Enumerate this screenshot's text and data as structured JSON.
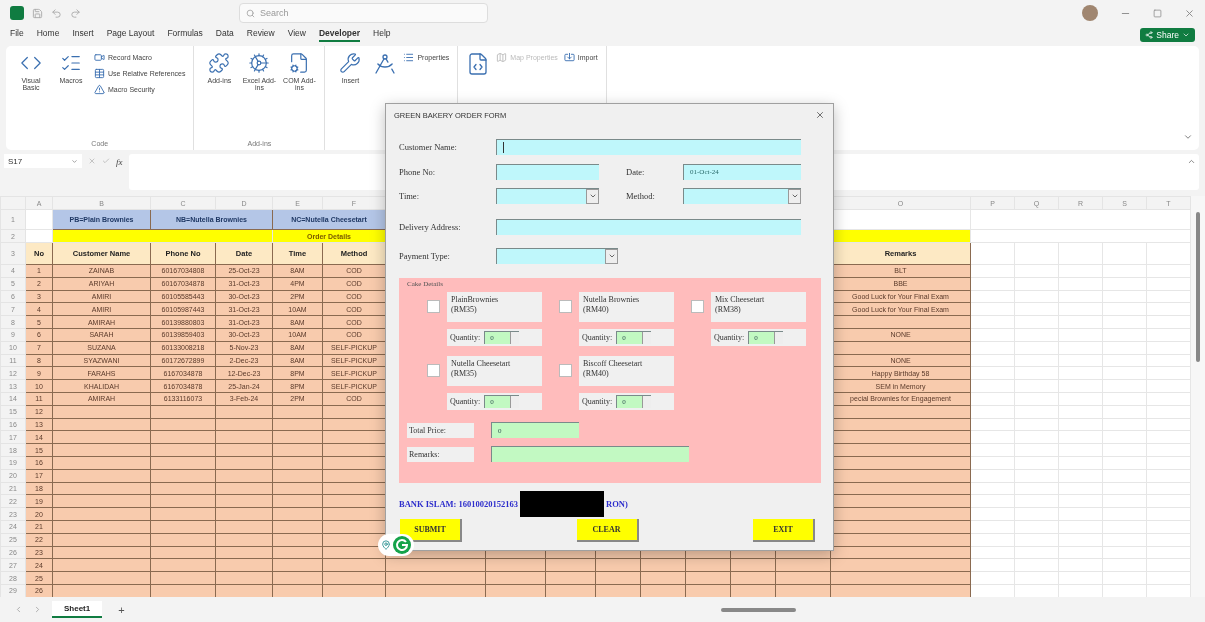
{
  "title_bar": {
    "search_placeholder": "Search"
  },
  "menu_tabs": [
    {
      "label": "File",
      "selected": false
    },
    {
      "label": "Home",
      "selected": false
    },
    {
      "label": "Insert",
      "selected": false
    },
    {
      "label": "Page Layout",
      "selected": false
    },
    {
      "label": "Formulas",
      "selected": false
    },
    {
      "label": "Data",
      "selected": false
    },
    {
      "label": "Review",
      "selected": false
    },
    {
      "label": "View",
      "selected": false
    },
    {
      "label": "Developer",
      "selected": true
    },
    {
      "label": "Help",
      "selected": false
    }
  ],
  "share_button": "Share",
  "ribbon": [
    {
      "label": "Code",
      "items": [
        {
          "kind": "large",
          "label": "Visual Basic"
        },
        {
          "kind": "large",
          "label": "Macros"
        },
        {
          "kind": "stack",
          "items": [
            {
              "label": "Record Macro",
              "disabled": false
            },
            {
              "label": "Use Relative References",
              "disabled": false
            },
            {
              "label": "Macro Security",
              "disabled": false
            }
          ]
        }
      ]
    },
    {
      "label": "Add-ins",
      "items": [
        {
          "kind": "large",
          "label": "Add-ins"
        },
        {
          "kind": "large",
          "label": "Excel Add-ins"
        },
        {
          "kind": "large",
          "label": "COM Add-ins"
        }
      ]
    },
    {
      "items": [
        {
          "kind": "large",
          "label": "Insert"
        },
        {
          "kind": "icon"
        },
        {
          "kind": "stack",
          "items": [
            {
              "label": "Properties",
              "disabled": false
            }
          ]
        }
      ]
    },
    {
      "items": [
        {
          "kind": "icon"
        },
        {
          "kind": "stack",
          "items": [
            {
              "label": "Map Properties",
              "disabled": true
            }
          ]
        },
        {
          "kind": "stack",
          "items": [
            {
              "label": "Import",
              "disabled": false
            }
          ]
        }
      ]
    }
  ],
  "formula_bar": {
    "name_box": "S17",
    "fx": "fx"
  },
  "sheet": {
    "column_letters": [
      "A",
      "B",
      "C",
      "D",
      "E",
      "F",
      "O",
      "P",
      "Q",
      "R",
      "S",
      "T"
    ],
    "banner": [
      "PB=Plain Brownies",
      "NB=Nutella Brownies",
      "NC=Nutella Cheesetart"
    ],
    "section_title": "Order Details",
    "headers": [
      "No",
      "Customer Name",
      "Phone No",
      "Date",
      "Time",
      "Method",
      "Remarks"
    ],
    "row_numbers": [
      "1",
      "2",
      "3",
      "4",
      "5",
      "6",
      "7",
      "8",
      "9",
      "10",
      "11",
      "12",
      "13",
      "14",
      "15",
      "16",
      "17",
      "18",
      "19",
      "20",
      "21",
      "22",
      "23",
      "24",
      "25",
      "26",
      "27",
      "28",
      "29"
    ],
    "rows": [
      {
        "no": "1",
        "name": "ZAINAB",
        "phone": "60167034808",
        "date": "25-Oct-23",
        "time": "8AM",
        "method": "COD",
        "remarks": "BLT"
      },
      {
        "no": "2",
        "name": "ARIYAH",
        "phone": "60167034878",
        "date": "31-Oct-23",
        "time": "4PM",
        "method": "COD",
        "remarks": "BBE"
      },
      {
        "no": "3",
        "name": "AMIRI",
        "phone": "60105585443",
        "date": "30-Oct-23",
        "time": "2PM",
        "method": "COD",
        "remarks": "Good Luck for Your Final Exam"
      },
      {
        "no": "4",
        "name": "AMIRI",
        "phone": "60105987443",
        "date": "31-Oct-23",
        "time": "10AM",
        "method": "COD",
        "remarks": "Good Luck for Your Final Exam"
      },
      {
        "no": "5",
        "name": "AMIRAH",
        "phone": "60139880803",
        "date": "31-Oct-23",
        "time": "8AM",
        "method": "COD"
      },
      {
        "no": "6",
        "name": "SARAH",
        "phone": "60139859403",
        "date": "30-Oct-23",
        "time": "10AM",
        "method": "COD",
        "remarks": "NONE"
      },
      {
        "no": "7",
        "name": "SUZANA",
        "phone": "60133008218",
        "date": "5-Nov-23",
        "time": "8AM",
        "method": "SELF-PICKUP"
      },
      {
        "no": "8",
        "name": "SYAZWANI",
        "phone": "60172672899",
        "date": "2-Dec-23",
        "time": "8AM",
        "method": "SELF-PICKUP",
        "remarks": "NONE"
      },
      {
        "no": "9",
        "name": "FARAHS",
        "phone": "6167034878",
        "date": "12-Dec-23",
        "time": "8PM",
        "method": "SELF-PICKUP",
        "remarks": "Happy Birthday 58"
      },
      {
        "no": "10",
        "name": "KHALIDAH",
        "phone": "6167034878",
        "date": "25-Jan-24",
        "time": "8PM",
        "method": "SELF-PICKUP",
        "remarks": "SEM in Memory"
      },
      {
        "no": "11",
        "name": "AMIRAH",
        "phone": "6133116073",
        "date": "3-Feb-24",
        "time": "2PM",
        "method": "COD",
        "remarks": "pecial Brownies for Engagement"
      },
      {
        "no": "12"
      },
      {
        "no": "13"
      },
      {
        "no": "14"
      },
      {
        "no": "15"
      },
      {
        "no": "16"
      },
      {
        "no": "17"
      },
      {
        "no": "18"
      },
      {
        "no": "19"
      },
      {
        "no": "20"
      },
      {
        "no": "21"
      },
      {
        "no": "22"
      },
      {
        "no": "23"
      },
      {
        "no": "24"
      },
      {
        "no": "25"
      },
      {
        "no": "26"
      }
    ]
  },
  "dialog": {
    "title": "GREEN BAKERY ORDER FORM",
    "form_rows": [
      [
        {
          "label": "Customer Name:",
          "kind": "text",
          "focused": true
        }
      ],
      [
        {
          "label": "Phone No:",
          "kind": "text",
          "focused": false
        },
        {
          "label": "Date:",
          "kind": "text",
          "focused": false,
          "value": "01-Oct-24"
        }
      ],
      [
        {
          "label": "Time:",
          "kind": "combo",
          "focused": false
        },
        {
          "label": "Method:",
          "kind": "combo",
          "focused": false
        }
      ],
      [
        {
          "label": "Delivery Address:",
          "kind": "text",
          "focused": false
        }
      ],
      [
        {
          "label": "Payment Type:",
          "kind": "combo",
          "focused": false
        }
      ]
    ],
    "cake_details": {
      "title": "Cake Details",
      "items": [
        {
          "label": "PlainBrownies (RM35)",
          "checked": false,
          "quantity_label": "Quantity:",
          "quantity": "0"
        },
        {
          "label": "Nutella Brownies (RM40)",
          "checked": false,
          "quantity_label": "Quantity:",
          "quantity": "0"
        },
        {
          "label": "Mix Cheesetart (RM38)",
          "checked": false,
          "quantity_label": "Quantity:",
          "quantity": "0"
        },
        {
          "label": "Nutella Cheesetart (RM35)",
          "checked": false,
          "quantity_label": "Quantity:",
          "quantity": "0"
        },
        {
          "label": "Biscoff Cheesetart (RM40)",
          "checked": false,
          "quantity_label": "Quantity:",
          "quantity": "0"
        }
      ],
      "total_label": "Total Price:",
      "total": "0",
      "remarks_label": "Remarks:"
    },
    "bank_text": "BANK ISLAM: 16010020152163",
    "bank_text_end": "RON)",
    "buttons": [
      "SUBMIT",
      "CLEAR",
      "EXIT"
    ]
  },
  "sheet_tabs": [
    {
      "label": "Sheet1",
      "selected": true
    }
  ],
  "add_sheet": "+"
}
